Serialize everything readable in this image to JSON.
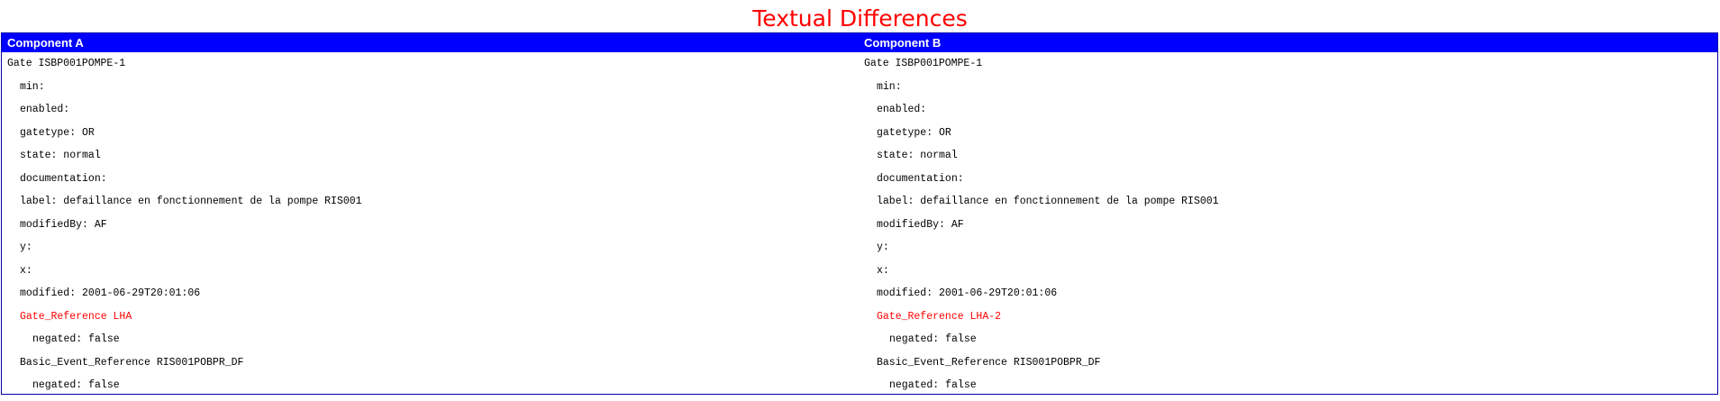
{
  "page": {
    "title": "Textual Differences"
  },
  "colors": {
    "title": "#ff0000",
    "header_bg": "#0000ff",
    "header_text": "#ffffff",
    "border": "#0000aa",
    "changed_text": "#ff0000"
  },
  "component_a": {
    "header": "Component A",
    "lines": [
      {
        "text": "Gate ISBP001POMPE-1",
        "indent": 0,
        "changed": false
      },
      {
        "text": "min:",
        "indent": 1,
        "changed": false
      },
      {
        "text": "enabled:",
        "indent": 1,
        "changed": false
      },
      {
        "text": "gatetype: OR",
        "indent": 1,
        "changed": false
      },
      {
        "text": "state: normal",
        "indent": 1,
        "changed": false
      },
      {
        "text": "documentation:",
        "indent": 1,
        "changed": false
      },
      {
        "text": "label: defaillance en fonctionnement de la pompe RIS001",
        "indent": 1,
        "changed": false
      },
      {
        "text": "modifiedBy: AF",
        "indent": 1,
        "changed": false
      },
      {
        "text": "y:",
        "indent": 1,
        "changed": false
      },
      {
        "text": "x:",
        "indent": 1,
        "changed": false
      },
      {
        "text": "modified: 2001-06-29T20:01:06",
        "indent": 1,
        "changed": false
      },
      {
        "text": "Gate_Reference LHA",
        "indent": 1,
        "changed": true
      },
      {
        "text": "negated: false",
        "indent": 2,
        "changed": false
      },
      {
        "text": "Basic_Event_Reference RIS001POBPR_DF",
        "indent": 1,
        "changed": false
      },
      {
        "text": "negated: false",
        "indent": 2,
        "changed": false
      }
    ]
  },
  "component_b": {
    "header": "Component B",
    "lines": [
      {
        "text": "Gate ISBP001POMPE-1",
        "indent": 0,
        "changed": false
      },
      {
        "text": "min:",
        "indent": 1,
        "changed": false
      },
      {
        "text": "enabled:",
        "indent": 1,
        "changed": false
      },
      {
        "text": "gatetype: OR",
        "indent": 1,
        "changed": false
      },
      {
        "text": "state: normal",
        "indent": 1,
        "changed": false
      },
      {
        "text": "documentation:",
        "indent": 1,
        "changed": false
      },
      {
        "text": "label: defaillance en fonctionnement de la pompe RIS001",
        "indent": 1,
        "changed": false
      },
      {
        "text": "modifiedBy: AF",
        "indent": 1,
        "changed": false
      },
      {
        "text": "y:",
        "indent": 1,
        "changed": false
      },
      {
        "text": "x:",
        "indent": 1,
        "changed": false
      },
      {
        "text": "modified: 2001-06-29T20:01:06",
        "indent": 1,
        "changed": false
      },
      {
        "text": "Gate_Reference LHA-2",
        "indent": 1,
        "changed": true
      },
      {
        "text": "negated: false",
        "indent": 2,
        "changed": false
      },
      {
        "text": "Basic_Event_Reference RIS001POBPR_DF",
        "indent": 1,
        "changed": false
      },
      {
        "text": "negated: false",
        "indent": 2,
        "changed": false
      }
    ]
  }
}
